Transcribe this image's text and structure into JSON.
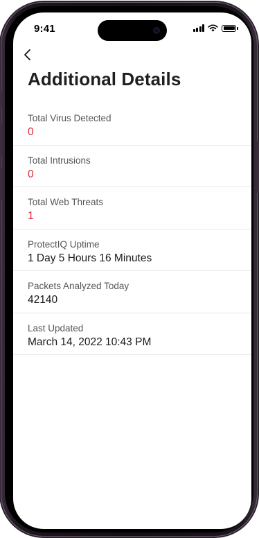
{
  "status_bar": {
    "time": "9:41"
  },
  "colors": {
    "alert_value": "#e5253a",
    "text_primary": "#1a1a1a",
    "text_label": "#555555",
    "divider": "#e9e9ec"
  },
  "nav": {
    "back_icon": "chevron-left-icon"
  },
  "page": {
    "title": "Additional Details"
  },
  "details": [
    {
      "label": "Total Virus Detected",
      "value": "0"
    },
    {
      "label": "Total Intrusions",
      "value": "0"
    },
    {
      "label": "Total Web Threats",
      "value": "1"
    },
    {
      "label": "ProtectIQ Uptime",
      "value": "1 Day 5 Hours 16 Minutes"
    },
    {
      "label": "Packets Analyzed Today",
      "value": "42140"
    },
    {
      "label": "Last Updated",
      "value": "March 14, 2022 10:43 PM"
    }
  ]
}
